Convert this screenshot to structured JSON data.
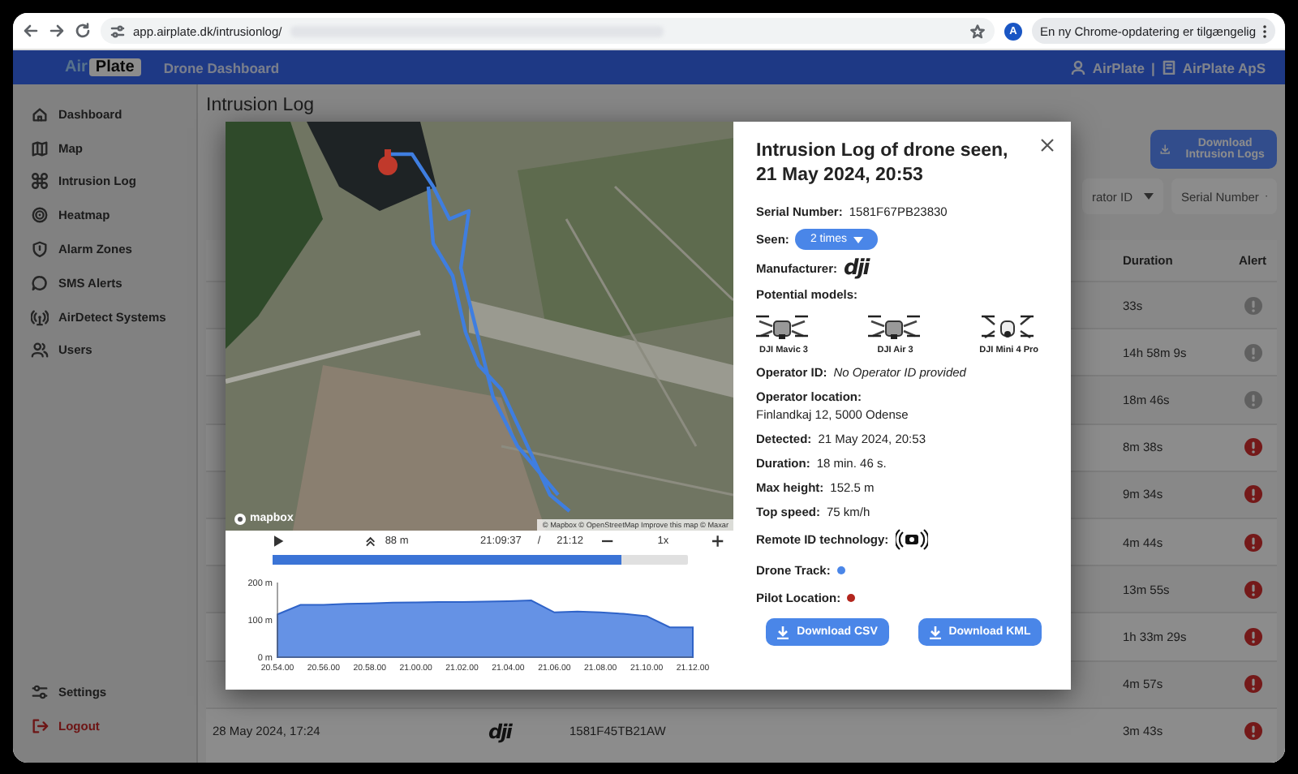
{
  "browser": {
    "url": "app.airplate.dk/intrusionlog/",
    "profile_initial": "A",
    "update_notice": "En ny Chrome-opdatering er tilgængelig"
  },
  "header": {
    "logo_left": "Air",
    "logo_right": "Plate",
    "title": "Drone Dashboard",
    "user": "AirPlate",
    "separator": "|",
    "company": "AirPlate ApS"
  },
  "sidebar": {
    "items": [
      {
        "label": "Dashboard"
      },
      {
        "label": "Map"
      },
      {
        "label": "Intrusion Log"
      },
      {
        "label": "Heatmap"
      },
      {
        "label": "Alarm Zones"
      },
      {
        "label": "SMS Alerts"
      },
      {
        "label": "AirDetect Systems"
      },
      {
        "label": "Users"
      }
    ],
    "bottom_items": [
      {
        "label": "Settings",
        "kind": "normal"
      },
      {
        "label": "Logout",
        "kind": "danger"
      }
    ]
  },
  "page": {
    "title": "Intrusion Log",
    "download_button": "Download Intrusion Logs",
    "filters": [
      "rator ID",
      "Serial Number"
    ],
    "table": {
      "columns": [
        "Duration",
        "Alert"
      ],
      "rows": [
        {
          "duration": "33s",
          "alert": false
        },
        {
          "duration": "14h 58m 9s",
          "alert": false
        },
        {
          "duration": "18m 46s",
          "alert": false
        },
        {
          "duration": "8m 38s",
          "alert": true
        },
        {
          "duration": "9m 34s",
          "alert": true
        },
        {
          "duration": "4m 44s",
          "alert": true
        },
        {
          "duration": "13m 55s",
          "alert": true
        },
        {
          "duration": "1h 33m 29s",
          "alert": true
        },
        {
          "duration": "4m 57s",
          "alert": true
        },
        {
          "date": "28 May 2024, 17:24",
          "manufacturer": "dji",
          "serial": "1581F45TB21AW",
          "duration": "3m 43s",
          "alert": true
        }
      ]
    }
  },
  "modal": {
    "map": {
      "logo": "mapbox",
      "attribution": "© Mapbox © OpenStreetMap Improve this map © Maxar"
    },
    "playback": {
      "altitude": "88 m",
      "current_time": "21:09:37",
      "separator": "/",
      "end_time": "21:12",
      "speed": "1x",
      "level": 0.84
    },
    "chart_data": {
      "type": "area",
      "categories": [
        "20.54.00",
        null,
        "20.56.00",
        null,
        "20.58.00",
        null,
        "21.00.00",
        null,
        "21.02.00",
        null,
        "21.04.00",
        null,
        "21.06.00",
        null,
        "21.08.00",
        null,
        "21.10.00",
        null,
        "21.12.00"
      ],
      "series": [
        {
          "color": "#4a7fe0",
          "values": [
            115,
            140,
            140,
            143,
            144,
            146,
            147,
            148,
            148,
            149,
            150,
            152,
            120,
            122,
            120,
            116,
            110,
            80,
            80
          ]
        }
      ],
      "ylim": [
        0,
        200
      ],
      "yticks": [
        {
          "value": 0,
          "label": "0 m"
        },
        {
          "value": 100,
          "label": "100 m"
        },
        {
          "value": 200,
          "label": "200 m"
        }
      ]
    },
    "details": {
      "title": "Intrusion Log of drone seen, 21 May 2024, 20:53",
      "serial_label": "Serial Number:",
      "serial": "1581F67PB23830",
      "seen_label": "Seen:",
      "seen": "2 times",
      "manufacturer_label": "Manufacturer:",
      "manufacturer": "dji",
      "models_label": "Potential models:",
      "models": [
        "DJI Mavic 3",
        "DJI Air 3",
        "DJI Mini 4 Pro"
      ],
      "fields": [
        {
          "label": "Operator ID:",
          "value": "No Operator ID provided",
          "kind": "missing"
        },
        {
          "label": "Operator location:",
          "value": "Finlandkaj 12, 5000 Odense",
          "kind": "block"
        },
        {
          "label": "Detected:",
          "value": "21 May 2024, 20:53",
          "kind": "inline"
        },
        {
          "label": "Duration:",
          "value": "18 min. 46 s.",
          "kind": "inline"
        },
        {
          "label": "Max height:",
          "value": "152.5 m",
          "kind": "inline"
        },
        {
          "label": "Top speed:",
          "value": "75 km/h",
          "kind": "inline"
        }
      ],
      "remote_id_label": "Remote ID technology:",
      "legend": [
        {
          "label": "Drone Track:",
          "color": "#4a86e8"
        },
        {
          "label": "Pilot Location:",
          "color": "#b3261e"
        }
      ],
      "buttons": [
        "Download CSV",
        "Download KML"
      ]
    }
  }
}
